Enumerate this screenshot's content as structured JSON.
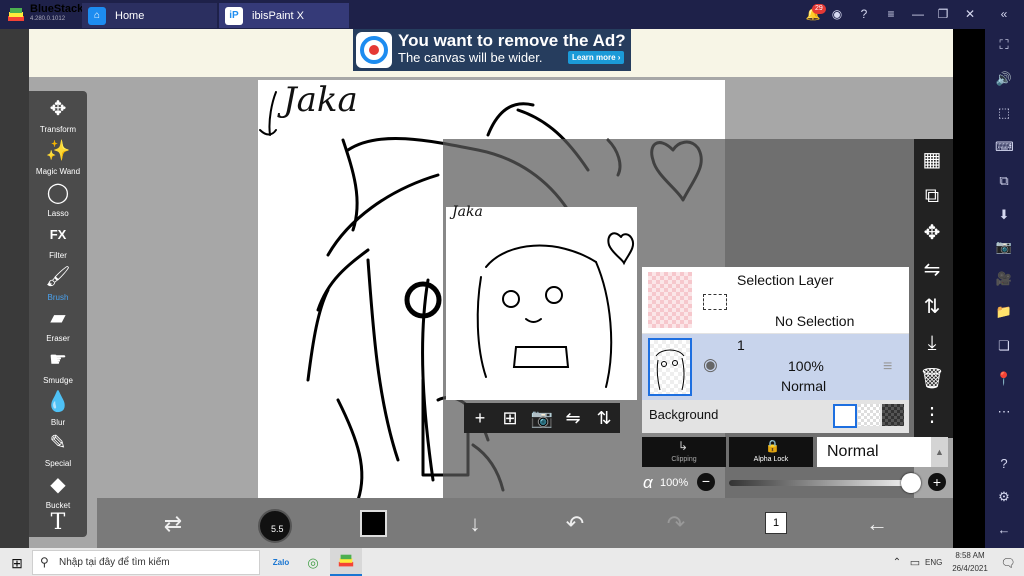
{
  "window": {
    "app_name": "BlueStacks",
    "version": "4.280.0.1012",
    "tabs": [
      {
        "label": "Home"
      },
      {
        "label": "ibisPaint X"
      }
    ],
    "notification_count": "29"
  },
  "ad": {
    "title": "You want to remove the Ad?",
    "subtitle": "The canvas will be wider.",
    "button": "Learn more ›"
  },
  "tools": [
    {
      "label": "Transform",
      "icon": "move-arrows-icon",
      "glyph": "✥"
    },
    {
      "label": "Magic Wand",
      "icon": "magic-wand-icon",
      "glyph": "✨"
    },
    {
      "label": "Lasso",
      "icon": "lasso-icon",
      "glyph": "◯"
    },
    {
      "label": "Filter",
      "icon": "fx-icon",
      "glyph": "FX"
    },
    {
      "label": "Brush",
      "icon": "brush-icon",
      "glyph": "🖌"
    },
    {
      "label": "Eraser",
      "icon": "eraser-icon",
      "glyph": "▰"
    },
    {
      "label": "Smudge",
      "icon": "smudge-icon",
      "glyph": "☛"
    },
    {
      "label": "Blur",
      "icon": "blur-drop-icon",
      "glyph": "💧"
    },
    {
      "label": "Special",
      "icon": "special-pen-icon",
      "glyph": "✎"
    },
    {
      "label": "Bucket",
      "icon": "bucket-icon",
      "glyph": "◆"
    },
    {
      "label": "",
      "icon": "text-tool-icon",
      "glyph": "T"
    }
  ],
  "active_tool": "Brush",
  "canvas_text": "Jaka",
  "brush_size": "5.5",
  "layers": {
    "selection_layer": {
      "title": "Selection Layer",
      "status": "No Selection"
    },
    "layer1": {
      "number": "1",
      "opacity": "100%",
      "blend": "Normal"
    },
    "background_label": "Background"
  },
  "blend_controls": {
    "clipping_label": "Clipping",
    "alpha_lock_label": "Alpha Lock",
    "blend_mode": "Normal",
    "alpha_symbol": "α",
    "opacity_value": "100%",
    "opacity_fraction": 1.0
  },
  "taskbar": {
    "search_placeholder": "Nhập tại đây để tìm kiếm",
    "language": "ENG",
    "time": "8:58 AM",
    "date": "26/4/2021"
  },
  "colors": {
    "accent": "#4aa3f0",
    "brush_color": "#000000",
    "titlebar": "#1e2149"
  }
}
